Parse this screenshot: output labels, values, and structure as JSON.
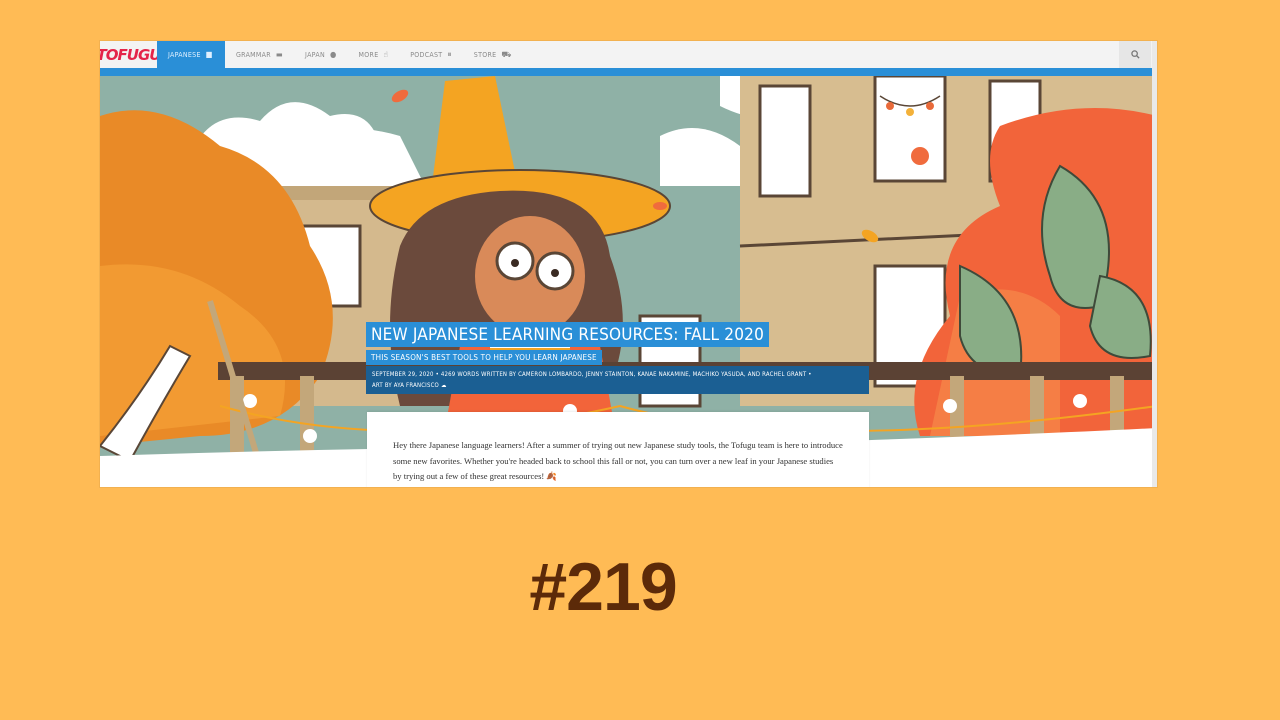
{
  "nav": {
    "logo": "TOFUGU",
    "items": [
      {
        "label": "JAPANESE",
        "icon": "chat-icon",
        "glyph": "💬",
        "active": true
      },
      {
        "label": "GRAMMAR",
        "icon": "book-icon",
        "glyph": "▬",
        "active": false
      },
      {
        "label": "JAPAN",
        "icon": "globe-icon",
        "glyph": "●",
        "active": false
      },
      {
        "label": "MORE",
        "icon": "hand-icon",
        "glyph": "✋",
        "active": false
      },
      {
        "label": "PODCAST",
        "icon": "microphone-icon",
        "glyph": "🎙",
        "active": false
      },
      {
        "label": "STORE",
        "icon": "cart-icon",
        "glyph": "🛒",
        "active": false
      }
    ],
    "search_icon": "search-icon",
    "search_glyph": "🔍"
  },
  "article": {
    "title": "NEW JAPANESE LEARNING RESOURCES: FALL 2020",
    "subtitle": "THIS SEASON'S BEST TOOLS TO HELP YOU LEARN JAPANESE",
    "meta_line1": "SEPTEMBER 29, 2020 • 4269 WORDS WRITTEN BY CAMERON LOMBARDO, JENNY STAINTON, KANAE NAKAMINE, MACHIKO YASUDA, AND RACHEL GRANT •",
    "meta_line2": "ART BY AYA FRANCISCO",
    "meta_icon": "cloud-icon",
    "body": "Hey there Japanese language learners! After a summer of trying out new Japanese study tools, the Tofugu team is here to introduce some new favorites. Whether you're headed back to school this fall or not, you can turn over a new leaf in your Japanese studies by trying out a few of these great resources! 🍂"
  },
  "episode_number": "#219",
  "colors": {
    "background": "#FFBB55",
    "accent_blue": "#2a8fd7",
    "meta_blue": "#1b5f93",
    "number_brown": "#5c2a09",
    "logo_red": "#e4244a"
  }
}
